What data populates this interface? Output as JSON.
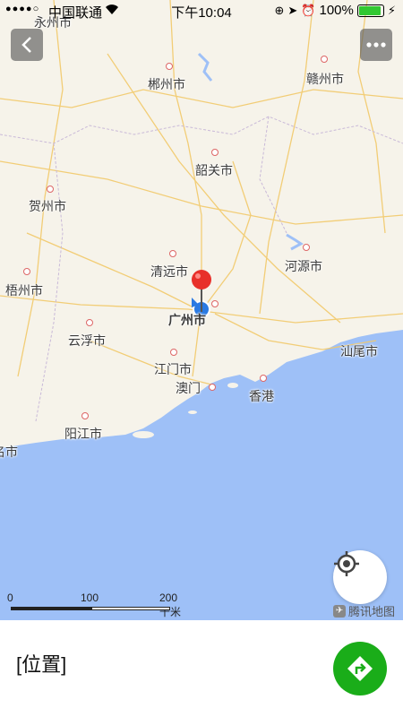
{
  "status_bar": {
    "signal": "●●●●○",
    "carrier": "中国联通",
    "time": "下午10:04",
    "battery_percent": "100%",
    "battery_level": 1.0
  },
  "nav": {
    "back_icon": "chevron-left-icon",
    "more_icon": "more-dots-icon"
  },
  "map": {
    "cities": [
      "永州市",
      "郴州市",
      "赣州市",
      "韶关市",
      "贺州市",
      "清远市",
      "河源市",
      "梧州市",
      "广州市",
      "云浮市",
      "汕尾市",
      "江门市",
      "澳门",
      "香港",
      "阳江市",
      "茂名市"
    ],
    "scale": {
      "zero": "0",
      "mid": "100",
      "max": "200 千米"
    },
    "provider": "腾讯地图",
    "colors": {
      "land": "#f6f3ea",
      "sea": "#9ec0f7",
      "road": "#f2c96a",
      "pin": "#e8302a"
    }
  },
  "location": {
    "title": "[位置]"
  }
}
